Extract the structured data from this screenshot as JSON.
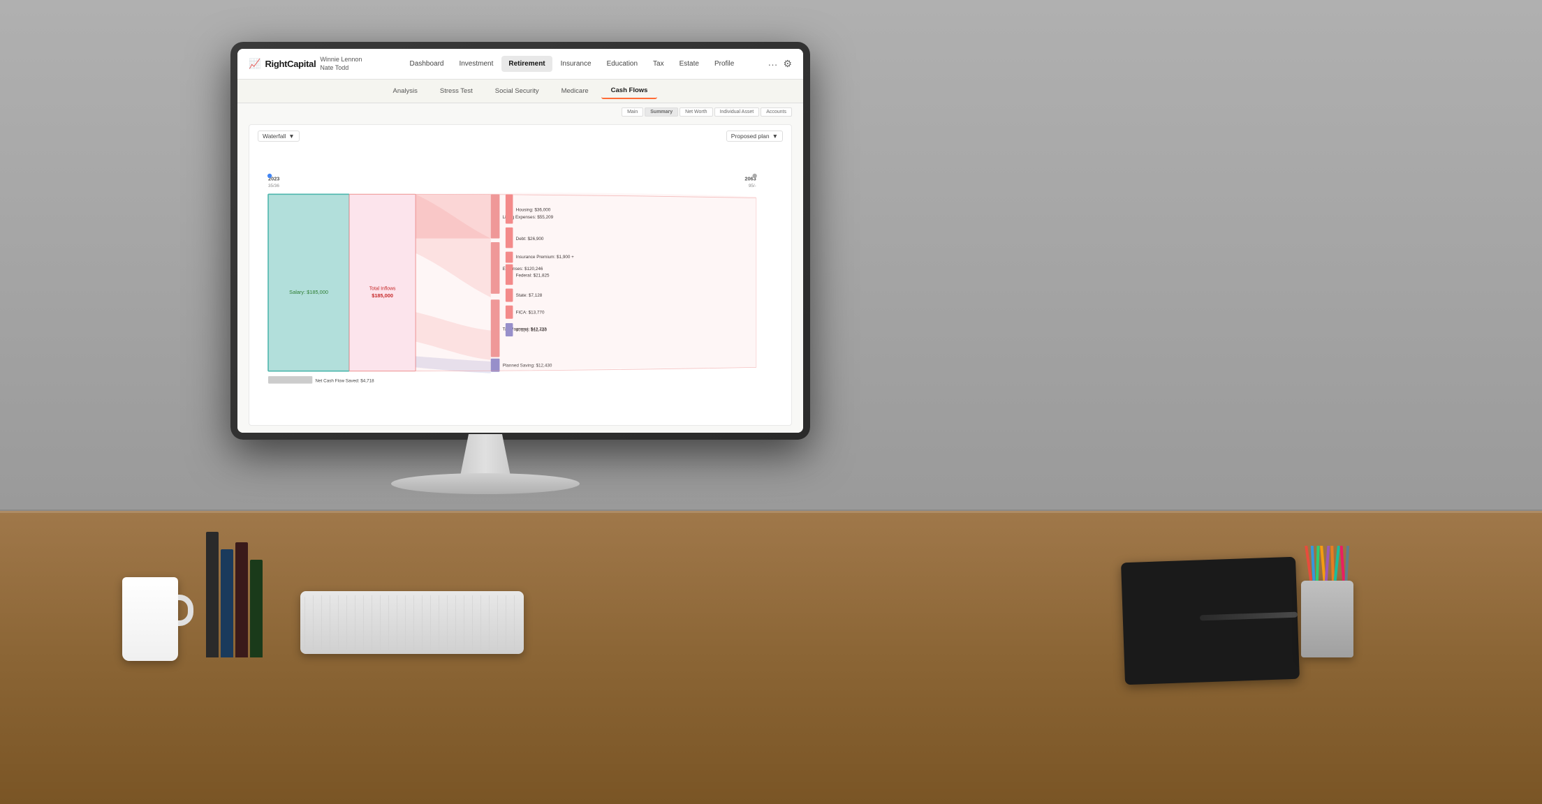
{
  "scene": {
    "wall_color": "#9a9a9a",
    "desk_color": "#8b6535"
  },
  "app": {
    "logo": "RightCapital",
    "logo_icon": "📈",
    "user": {
      "name1": "Winnie Lennon",
      "name2": "Nate Todd"
    }
  },
  "nav": {
    "items": [
      {
        "label": "Dashboard",
        "active": false
      },
      {
        "label": "Investment",
        "active": false
      },
      {
        "label": "Retirement",
        "active": true
      },
      {
        "label": "Insurance",
        "active": false
      },
      {
        "label": "Education",
        "active": false
      },
      {
        "label": "Tax",
        "active": false
      },
      {
        "label": "Estate",
        "active": false
      },
      {
        "label": "Profile",
        "active": false
      }
    ],
    "more_icon": "···",
    "settings_icon": "⚙"
  },
  "sub_tabs": {
    "items": [
      {
        "label": "Analysis",
        "active": false
      },
      {
        "label": "Stress Test",
        "active": false
      },
      {
        "label": "Social Security",
        "active": false
      },
      {
        "label": "Medicare",
        "active": false
      },
      {
        "label": "Cash Flows",
        "active": true
      }
    ]
  },
  "view_tabs": [
    "Main",
    "Summary",
    "Net Worth",
    "Individual Asset",
    "Accounts"
  ],
  "chart": {
    "type_dropdown": "Waterfall",
    "plan_dropdown": "Proposed plan",
    "year_start": "2023",
    "age_start": "35/36",
    "year_end": "2063",
    "age_end": "95/-",
    "salary_label": "Salary: $185,000",
    "total_inflows_label": "Total Inflows",
    "total_inflows_value": "$185,000",
    "outflows": [
      {
        "label": "Living Expenses: $55,209",
        "color": "#f48a8a"
      },
      {
        "label": "Expenses: $120,246",
        "color": "#f0a0a0"
      },
      {
        "label": "Housing: $36,000",
        "color": "#f48a8a"
      },
      {
        "label": "Debt: $26,900",
        "color": "#f48a8a"
      },
      {
        "label": "Insurance Premium: $1,900 +",
        "color": "#f48a8a"
      },
      {
        "label": "Federal: $21,825",
        "color": "#f48a8a"
      },
      {
        "label": "State: $7,128",
        "color": "#f48a8a"
      },
      {
        "label": "FICA: $13,770",
        "color": "#f48a8a"
      },
      {
        "label": "Tax Payment: $42,723",
        "color": "#f0a0a0"
      }
    ],
    "savings": [
      {
        "label": "Planned Saving: $12,430",
        "color": "#8080d0"
      },
      {
        "label": "401(k): $12,430",
        "color": "#8080d0"
      },
      {
        "label": "Net Cash Flow Saved: $4,718",
        "color": "#aaaaaa"
      }
    ]
  }
}
